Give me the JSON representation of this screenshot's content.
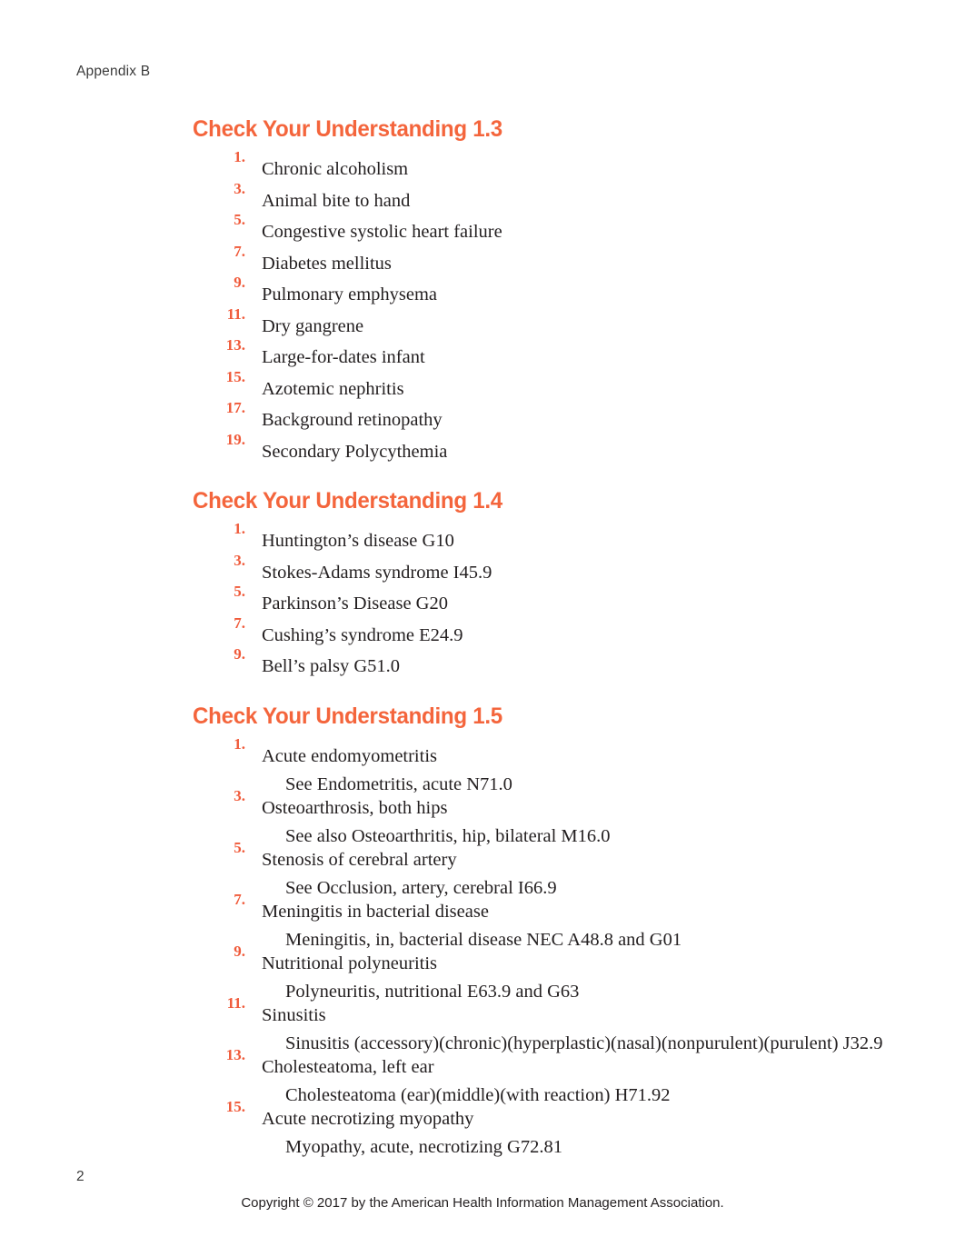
{
  "page": {
    "running_head": "Appendix B",
    "page_number": "2",
    "copyright": "Copyright © 2017 by the American Health Information Management Association.",
    "heading_color": "#f4653c",
    "number_color": "#f05a3a",
    "body_text_color": "#231f20"
  },
  "sections": [
    {
      "heading": "Check Your Understanding 1.3",
      "type": "single",
      "items": [
        {
          "number": "1.",
          "text": "Chronic alcoholism"
        },
        {
          "number": "3.",
          "text": "Animal bite to hand"
        },
        {
          "number": "5.",
          "text": "Congestive systolic heart failure"
        },
        {
          "number": "7.",
          "text": "Diabetes mellitus"
        },
        {
          "number": "9.",
          "text": "Pulmonary emphysema"
        },
        {
          "number": "11.",
          "text": "Dry gangrene"
        },
        {
          "number": "13.",
          "text": "Large-for-dates infant"
        },
        {
          "number": "15.",
          "text": "Azotemic nephritis"
        },
        {
          "number": "17.",
          "text": "Background retinopathy"
        },
        {
          "number": "19.",
          "text": "Secondary Polycythemia"
        }
      ]
    },
    {
      "heading": "Check Your Understanding 1.4",
      "type": "single",
      "items": [
        {
          "number": "1.",
          "text": "Huntington’s disease G10"
        },
        {
          "number": "3.",
          "text": "Stokes-Adams syndrome I45.9"
        },
        {
          "number": "5.",
          "text": "Parkinson’s Disease G20"
        },
        {
          "number": "7.",
          "text": "Cushing’s syndrome E24.9"
        },
        {
          "number": "9.",
          "text": "Bell’s palsy G51.0"
        }
      ]
    },
    {
      "heading": "Check Your Understanding 1.5",
      "type": "double",
      "items": [
        {
          "number": "1.",
          "text": "Acute endomyometritis",
          "sub": "See Endometritis, acute N71.0"
        },
        {
          "number": "3.",
          "text": "Osteoarthrosis, both hips",
          "sub": "See also Osteoarthritis, hip, bilateral M16.0"
        },
        {
          "number": "5.",
          "text": "Stenosis of cerebral artery",
          "sub": "See Occlusion, artery, cerebral I66.9"
        },
        {
          "number": "7.",
          "text": "Meningitis in bacterial disease",
          "sub": "Meningitis, in, bacterial disease NEC A48.8 and G01"
        },
        {
          "number": "9.",
          "text": "Nutritional polyneuritis",
          "sub": "Polyneuritis, nutritional E63.9 and G63"
        },
        {
          "number": "11.",
          "text": "Sinusitis",
          "sub": "Sinusitis (accessory)(chronic)(hyperplastic)(nasal)(nonpurulent)(purulent) J32.9"
        },
        {
          "number": "13.",
          "text": "Cholesteatoma, left ear",
          "sub": "Cholesteatoma (ear)(middle)(with reaction) H71.92"
        },
        {
          "number": "15.",
          "text": "Acute necrotizing myopathy",
          "sub": "Myopathy, acute, necrotizing G72.81"
        }
      ]
    }
  ]
}
